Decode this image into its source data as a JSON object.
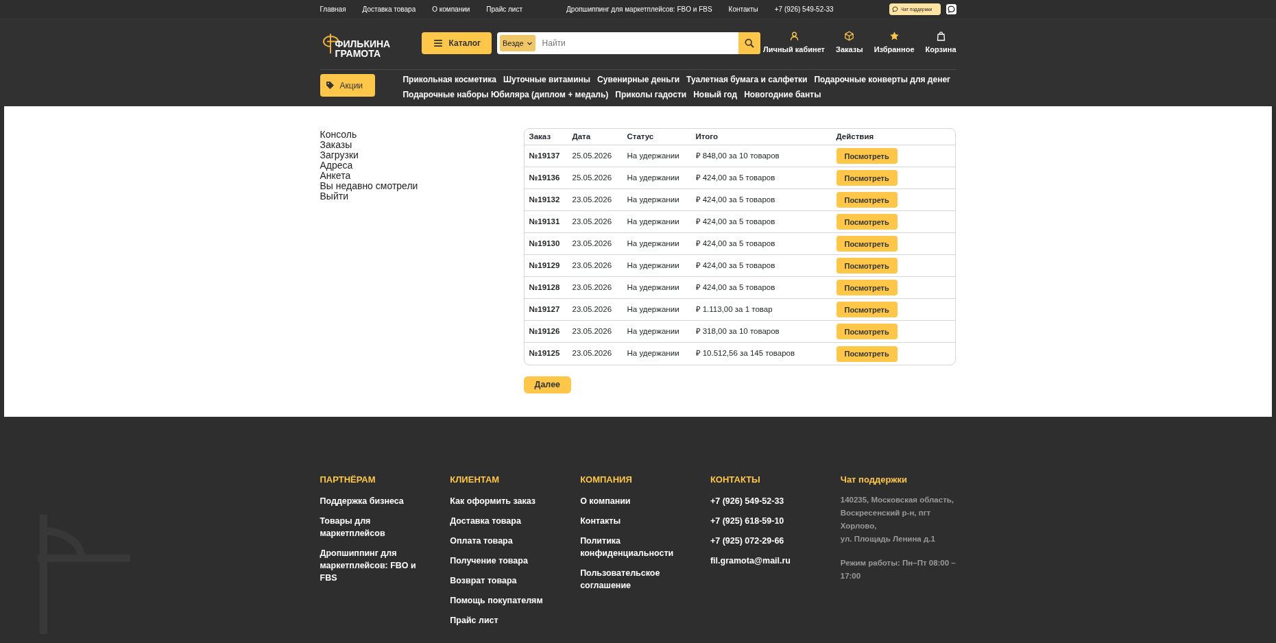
{
  "top_nav": {
    "left": [
      "Главная",
      "Доставка товара",
      "О компании",
      "Прайс лист"
    ],
    "right": [
      "Дропшиппинг для маркетплейсов: FBO и FBS",
      "Контакты",
      "+7 (926) 549-52-33"
    ],
    "chat_button": "Чат поддержки"
  },
  "header": {
    "logo": {
      "line1": "ФИЛЬКИНА",
      "line2": "ГРАМОТА"
    },
    "catalog_button": "Каталог",
    "search": {
      "scope": "Везде",
      "placeholder": "Найти"
    },
    "actions": [
      {
        "kind": "user",
        "label": "Личный кабинет"
      },
      {
        "kind": "box",
        "label": "Заказы"
      },
      {
        "kind": "star",
        "label": "Избранное"
      },
      {
        "kind": "bag",
        "label": "Корзина"
      }
    ],
    "promo_button": "Акции",
    "categories": [
      "Прикольная косметика",
      "Шуточные витамины",
      "Сувенирные деньги",
      "Туалетная бумага и салфетки",
      "Подарочные конверты для денег",
      "Подарочные наборы Юбиляра (диплом + медаль)",
      "Приколы гадости",
      "Новый год",
      "Новогодние банты"
    ]
  },
  "account_menu": [
    "Консоль",
    "Заказы",
    "Загрузки",
    "Адреса",
    "Анкета",
    "Вы недавно смотрели",
    "Выйти"
  ],
  "orders": {
    "columns": [
      "Заказ",
      "Дата",
      "Статус",
      "Итого",
      "Действия"
    ],
    "rows": [
      {
        "number": "№19137",
        "date": "25.05.2026",
        "status": "На удержании",
        "total": "₽ 848,00 за 10 товаров",
        "action": "Посмотреть"
      },
      {
        "number": "№19136",
        "date": "25.05.2026",
        "status": "На удержании",
        "total": "₽ 424,00 за 5 товаров",
        "action": "Посмотреть"
      },
      {
        "number": "№19132",
        "date": "23.05.2026",
        "status": "На удержании",
        "total": "₽ 424,00 за 5 товаров",
        "action": "Посмотреть"
      },
      {
        "number": "№19131",
        "date": "23.05.2026",
        "status": "На удержании",
        "total": "₽ 424,00 за 5 товаров",
        "action": "Посмотреть"
      },
      {
        "number": "№19130",
        "date": "23.05.2026",
        "status": "На удержании",
        "total": "₽ 424,00 за 5 товаров",
        "action": "Посмотреть"
      },
      {
        "number": "№19129",
        "date": "23.05.2026",
        "status": "На удержании",
        "total": "₽ 424,00 за 5 товаров",
        "action": "Посмотреть"
      },
      {
        "number": "№19128",
        "date": "23.05.2026",
        "status": "На удержании",
        "total": "₽ 424,00 за 5 товаров",
        "action": "Посмотреть"
      },
      {
        "number": "№19127",
        "date": "23.05.2026",
        "status": "На удержании",
        "total": "₽ 1.113,00 за 1 товар",
        "action": "Посмотреть"
      },
      {
        "number": "№19126",
        "date": "23.05.2026",
        "status": "На удержании",
        "total": "₽ 318,00 за 10 товаров",
        "action": "Посмотреть"
      },
      {
        "number": "№19125",
        "date": "23.05.2026",
        "status": "На удержании",
        "total": "₽ 10.512,56 за 145 товаров",
        "action": "Посмотреть"
      }
    ],
    "next_button": "Далее"
  },
  "footer": {
    "columns": [
      {
        "title": "ПАРТНЁРАМ",
        "links": [
          "Поддержка бизнеса",
          "Товары для маркетплейсов",
          "Дропшиппинг для маркетплейсов: FBO и FBS"
        ]
      },
      {
        "title": "КЛИЕНТАМ",
        "links": [
          "Как оформить заказ",
          "Доставка товара",
          "Оплата товара",
          "Получение товара",
          "Возврат товара",
          "Помощь покупателям",
          "Прайс лист"
        ]
      },
      {
        "title": "КОМПАНИЯ",
        "links": [
          "О компании",
          "Контакты",
          "Политика конфиденциальности",
          "Пользовательское соглашение"
        ]
      },
      {
        "title": "КОНТАКТЫ",
        "links": [
          "+7 (926) 549-52-33",
          "+7 (925) 618-59-10",
          "+7 (925) 072-29-66",
          "fil.gramota@mail.ru"
        ]
      }
    ],
    "support": {
      "link": "Чат поддержки",
      "address_lines": [
        "140235, Московская область, Воскресенский р-н, пгт Хорлово,",
        "ул. Площадь Ленина д.1"
      ],
      "hours": "Режим работы: Пн–Пт 08:00 – 17:00"
    }
  }
}
